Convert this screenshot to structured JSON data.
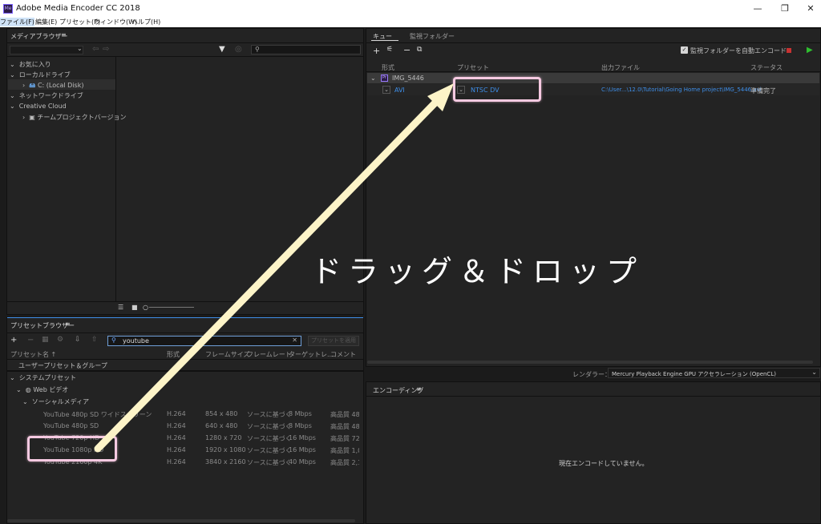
{
  "window": {
    "title": "Adobe Media Encoder CC 2018",
    "app_icon_text": "Me",
    "minimize": "—",
    "restore": "❐",
    "close": "✕"
  },
  "menu": [
    "ファイル(F)",
    "編集(E)",
    "プリセット(P)",
    "ウィンドウ(W)",
    "ヘルプ(H)"
  ],
  "media_browser": {
    "title": "メディアブラウザー",
    "tree": [
      {
        "label": "お気に入り",
        "level": 0
      },
      {
        "label": "ローカルドライブ",
        "level": 0
      },
      {
        "label": "C: (Local Disk)",
        "level": 1
      },
      {
        "label": "ネットワークドライブ",
        "level": 0
      },
      {
        "label": "Creative Cloud",
        "level": 0
      },
      {
        "label": "チームプロジェクトバージョン",
        "level": 1
      }
    ]
  },
  "queue": {
    "tabs": [
      "キュー",
      "監視フォルダー"
    ],
    "auto_encode_label": "監視フォルダーを自動エンコード",
    "headers": {
      "format": "形式",
      "preset": "プリセット",
      "output": "出力ファイル",
      "status": "ステータス"
    },
    "item_name": "IMG_5446",
    "item": {
      "format": "AVI",
      "preset": "NTSC DV",
      "output": "C:\\User...\\12.0\\Tutorial\\Going Home project\\IMG_5446.avi",
      "status": "準備完了"
    },
    "renderer_label": "レンダラー：",
    "renderer_value": "Mercury Playback Engine GPU アクセラレーション (OpenCL)"
  },
  "preset_browser": {
    "title": "プリセットブラウザー",
    "search_value": "youtube",
    "apply_button": "プリセットを適用",
    "headers": {
      "name": "プリセット名",
      "format": "形式",
      "frame_size": "フレームサイズ",
      "frame_rate": "フレームレート",
      "target": "ターゲットレ...",
      "comment": "コメント"
    },
    "groups": {
      "user": "ユーザープリセット＆グループ",
      "system": "システムプリセット",
      "web": "Web ビデオ",
      "social": "ソーシャルメディア"
    },
    "rows": [
      {
        "name": "YouTube 480p SD ワイドスクリーン",
        "format": "H.264",
        "size": "854 x 480",
        "rate": "ソースに基づく",
        "target": "8 Mbps",
        "comment": "高品質 48"
      },
      {
        "name": "YouTube 480p SD",
        "format": "H.264",
        "size": "640 x 480",
        "rate": "ソースに基づく",
        "target": "8 Mbps",
        "comment": "高品質 48"
      },
      {
        "name": "YouTube 720p HD",
        "format": "H.264",
        "size": "1280 x 720",
        "rate": "ソースに基づく",
        "target": "16 Mbps",
        "comment": "高品質 72"
      },
      {
        "name": "YouTube 1080p HD",
        "format": "H.264",
        "size": "1920 x 1080",
        "rate": "ソースに基づく",
        "target": "16 Mbps",
        "comment": "高品質 1,0"
      },
      {
        "name": "YouTube 2160p 4K",
        "format": "H.264",
        "size": "3840 x 2160",
        "rate": "ソースに基づく",
        "target": "40 Mbps",
        "comment": "高品質 2,1"
      }
    ]
  },
  "encoding": {
    "title": "エンコーディング",
    "empty_message": "現在エンコードしていません。"
  },
  "annotation": {
    "text": "ドラッグ＆ドロップ",
    "highlight_color": "#f6c9e1",
    "arrow_color": "#fdf4c8"
  },
  "colors": {
    "accent_blue": "#3e8ee8",
    "play_green": "#2fbf2f",
    "stop_red": "#c83232"
  }
}
